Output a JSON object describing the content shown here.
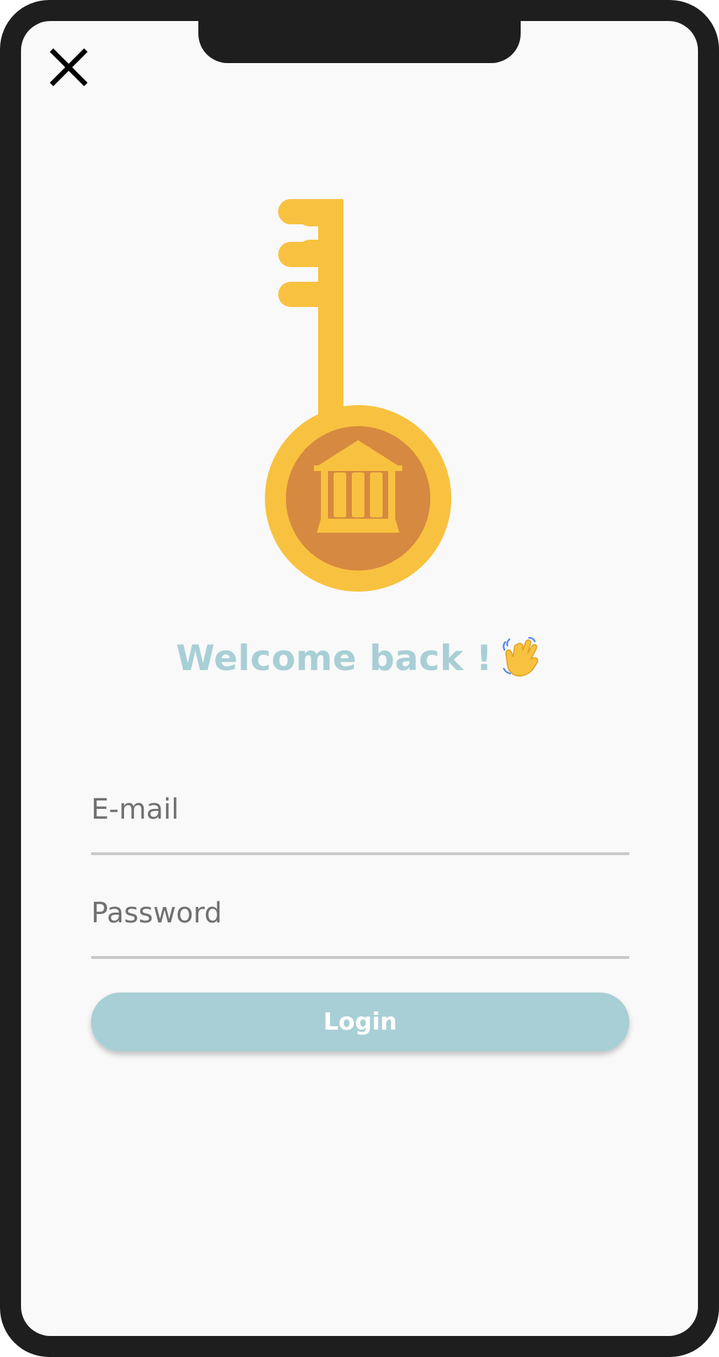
{
  "header": {
    "close_icon": "close-icon"
  },
  "logo": {
    "icon": "bank-key-icon",
    "colors": {
      "gold": "#f8c240",
      "coin_inner": "#d68940"
    }
  },
  "welcome": {
    "title": "Welcome back !",
    "wave_icon": "waving-hand-icon"
  },
  "form": {
    "email_placeholder": "E-mail",
    "password_placeholder": "Password",
    "login_label": "Login"
  },
  "colors": {
    "accent": "#a8cfd6",
    "frame": "#1e1e1e",
    "screen_bg": "#f9f9f9",
    "underline": "#c9c9c9"
  }
}
